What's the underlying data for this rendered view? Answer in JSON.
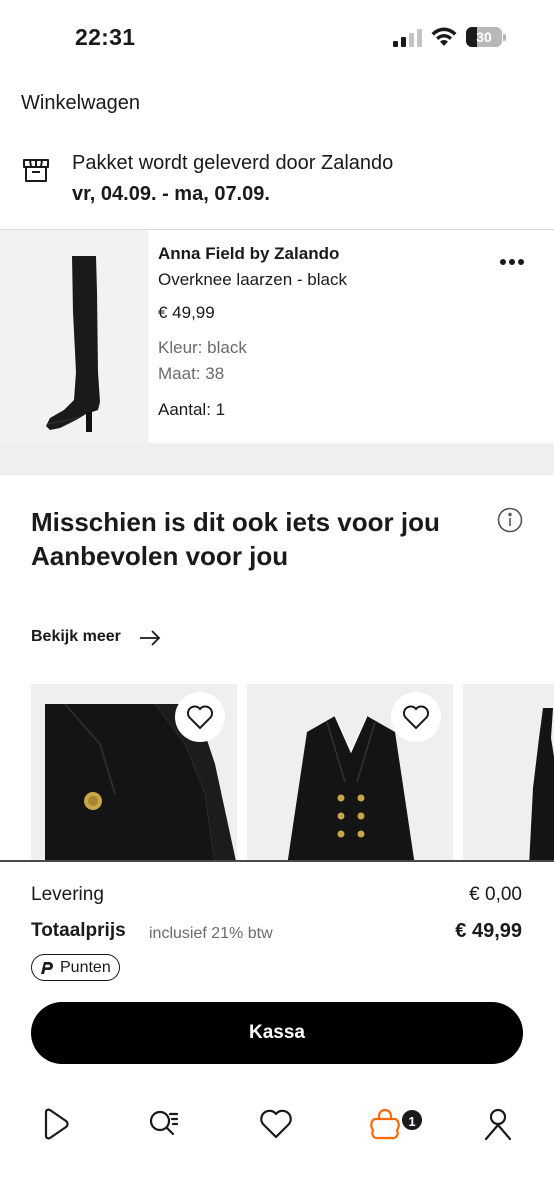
{
  "status_bar": {
    "time": "22:31",
    "battery": "30",
    "battery_level": 0.3
  },
  "header": {
    "title": "Winkelwagen"
  },
  "delivery": {
    "text": "Pakket wordt geleverd door Zalando",
    "dates": "vr, 04.09. - ma, 07.09."
  },
  "cart_item": {
    "brand": "Anna Field by Zalando",
    "name": "Overknee laarzen - black",
    "price": "€ 49,99",
    "color": "Kleur: black",
    "size": "Maat: 38",
    "quantity": "Aantal: 1"
  },
  "recommendations": {
    "title": "Misschien is dit ook iets voor jou\nAanbevolen voor jou",
    "see_more": "Bekijk meer"
  },
  "summary": {
    "delivery_label": "Levering",
    "delivery_value": "€ 0,00",
    "total_label": "Totaalprijs",
    "vat_label": "inclusief 21% btw",
    "total_value": "€ 49,99",
    "points_label": "Punten",
    "checkout_label": "Kassa"
  },
  "tab_bar": {
    "items": [
      "home-icon",
      "search-icon",
      "heart-icon",
      "bag-icon",
      "profile-icon"
    ],
    "cart_count": "1",
    "active_color": "#ff6900"
  }
}
